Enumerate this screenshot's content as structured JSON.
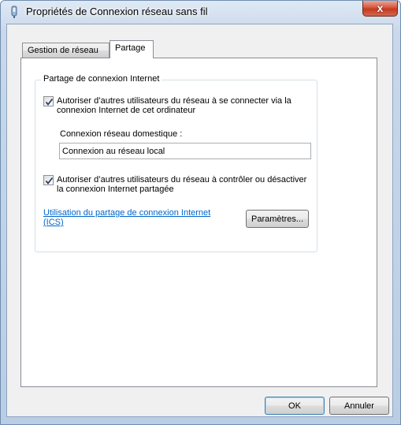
{
  "window": {
    "title": "Propriétés de Connexion réseau sans fil",
    "close_label": "x"
  },
  "tabs": [
    {
      "label": "Gestion de réseau",
      "active": false
    },
    {
      "label": "Partage",
      "active": true
    }
  ],
  "sharing": {
    "group_title": "Partage de connexion Internet",
    "allow_connect_label": "Autoriser d’autres utilisateurs du réseau à se connecter via la connexion Internet de cet ordinateur",
    "allow_connect_checked": true,
    "home_network_label": "Connexion réseau domestique :",
    "home_network_value": "Connexion au réseau local",
    "allow_control_label": "Autoriser d’autres utilisateurs du réseau à contrôler ou désactiver la connexion Internet partagée",
    "allow_control_checked": true,
    "ics_link": "Utilisation du partage de connexion Internet (ICS)",
    "settings_button": "Paramètres..."
  },
  "footer": {
    "ok_label": "OK",
    "cancel_label": "Annuler"
  },
  "colors": {
    "link": "#0066cc",
    "close_button": "#c23a22",
    "frame": "#c9d8ea"
  }
}
